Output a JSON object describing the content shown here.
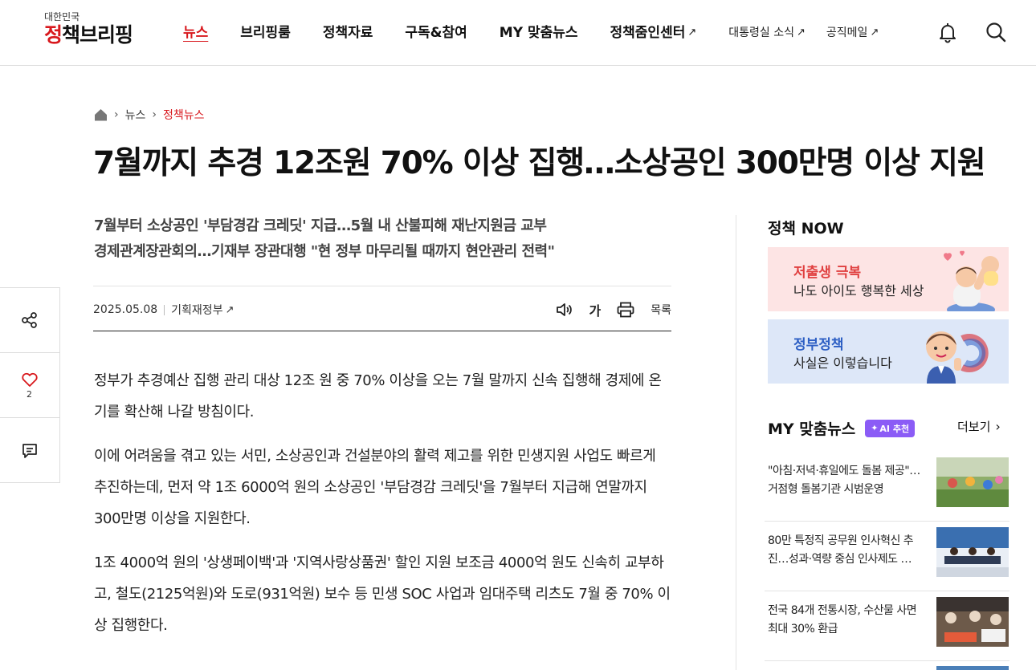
{
  "header": {
    "logo_sub": "대한민국",
    "logo_main_red": "정",
    "logo_main_rest": "책브리핑",
    "nav": [
      {
        "label": "뉴스",
        "active": true
      },
      {
        "label": "브리핑룸"
      },
      {
        "label": "정책자료"
      },
      {
        "label": "구독&참여"
      },
      {
        "label": "MY 맞춤뉴스"
      },
      {
        "label": "정책줌인센터",
        "external": true
      }
    ],
    "nav_small": [
      {
        "label": "대통령실 소식",
        "external": true
      },
      {
        "label": "공직메일",
        "external": true
      }
    ],
    "icons": [
      "bell-icon",
      "search-icon"
    ]
  },
  "breadcrumb": {
    "home_icon": "home-icon",
    "items": [
      "뉴스",
      "정책뉴스"
    ]
  },
  "article": {
    "title": "7월까지 추경 12조원 70% 이상 집행…소상공인 300만명 이상 지원",
    "subtitle_lines": [
      "7월부터 소상공인 '부담경감 크레딧' 지급…5월 내 산불피해 재난지원금 교부",
      "경제관계장관회의…기재부 장관대행 \"현 정부 마무리될 때까지 현안관리 전력\""
    ],
    "date": "2025.05.08",
    "department": "기획재정부",
    "tools": {
      "listen_icon": "speaker-icon",
      "font_size_label": "가",
      "print_icon": "print-icon",
      "list_label": "목록"
    },
    "paragraphs": [
      "정부가 추경예산 집행 관리 대상 12조 원 중 70% 이상을 오는 7월 말까지 신속 집행해 경제에 온기를 확산해 나갈 방침이다.",
      "이에 어려움을 겪고 있는 서민, 소상공인과 건설분야의 활력 제고를 위한 민생지원 사업도 빠르게 추진하는데, 먼저 약 1조 6000억 원의 소상공인 '부담경감 크레딧'을 7월부터 지급해 연말까지 300만명 이상을 지원한다.",
      "1조 4000억 원의 '상생페이백'과 '지역사랑상품권' 할인 지원 보조금 4000억 원도 신속히 교부하고, 철도(2125억원)와 도로(931억원) 보수 등 민생 SOC 사업과 임대주택 리츠도 7월 중 70% 이상 집행한다."
    ]
  },
  "side_actions": {
    "share_icon": "share-icon",
    "like_icon": "heart-icon",
    "like_count": "2",
    "comment_icon": "comment-icon"
  },
  "sidebar": {
    "policy_now_title": "정책 NOW",
    "banners": [
      {
        "title": "저출생 극복",
        "subtitle": "나도 아이도 행복한 세상"
      },
      {
        "title": "정부정책",
        "subtitle": "사실은 이렇습니다"
      }
    ],
    "my_news_title": "MY 맞춤뉴스",
    "ai_badge": "AI 추천",
    "more_label": "더보기",
    "news": [
      {
        "text": "\"아침·저녁·휴일에도 돌봄 제공\"…거점형 돌봄기관 시범운영"
      },
      {
        "text": "80만 특정직 공무원 인사혁신 추진…성과·역량 중심 인사제도 …"
      },
      {
        "text": "전국 84개 전통시장, 수산물 사면 최대 30% 환급"
      }
    ]
  }
}
